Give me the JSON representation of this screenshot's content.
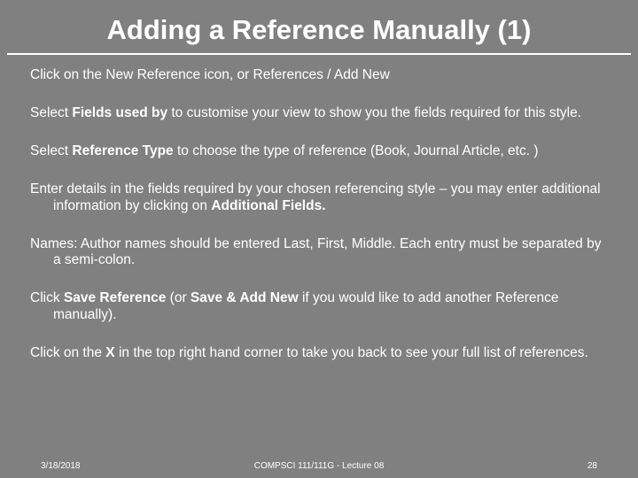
{
  "title": "Adding a  Reference Manually (1)",
  "p1a": "Click on the New Reference icon, or References / Add New",
  "p2a": "Select ",
  "p2b": "Fields used by",
  "p2c": " to customise your view to show you the fields required for this style.",
  "p3a": "Select ",
  "p3b": "Reference Type",
  "p3c": " to choose the type of reference (Book, Journal Article, etc. )",
  "p4a": "Enter details in the fields required by your chosen referencing style – you may enter additional information by clicking on ",
  "p4b": "Additional Fields.",
  "p5a": "Names: Author names should be entered Last, First, Middle. Each entry must be separated by a semi-colon.",
  "p6a": "Click ",
  "p6b": "Save Reference",
  "p6c": " (or ",
  "p6d": "Save & Add New",
  "p6e": " if you would like to add another Reference manually).",
  "p7a": "Click on the ",
  "p7b": "X",
  "p7c": " in the top right hand corner to take you back to see your full list of references.",
  "footer": {
    "date": "3/18/2018",
    "center": "COMPSCI 111/111G - Lecture 08",
    "page": "28"
  }
}
